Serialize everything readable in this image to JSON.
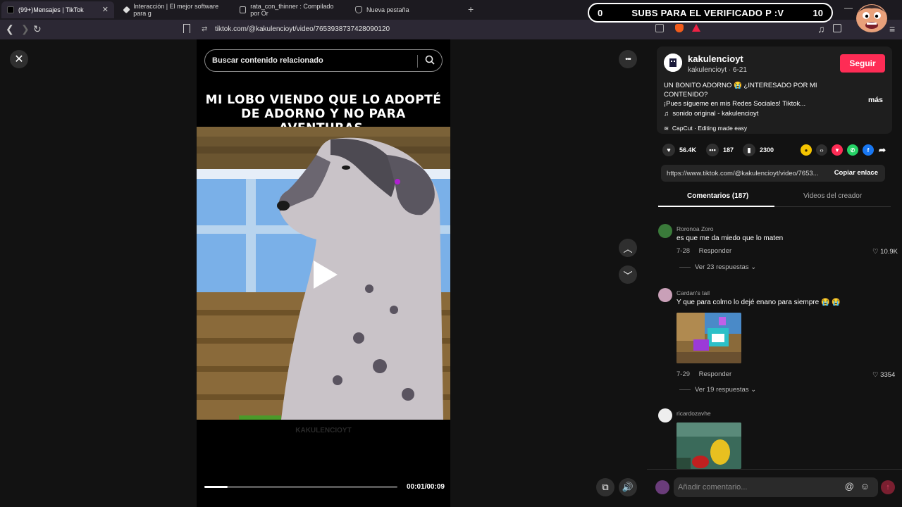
{
  "browser": {
    "tabs": [
      {
        "label": "(99+)Mensajes | TikTok",
        "favicon_color": "#000000"
      },
      {
        "label": "Interacción | El mejor software para g",
        "favicon_color": "#dddddd"
      },
      {
        "label": "rata_con_thinner : Compilado por Or",
        "favicon_color": "#bbbbbb"
      },
      {
        "label": "Nueva pestaña",
        "favicon_color": "#aaaaaa"
      }
    ],
    "tab_close": "✕",
    "new_tab": "+",
    "url": "tiktok.com/@kakulencioyt/video/7653938737428090120",
    "window_controls": {
      "minimize": "—"
    }
  },
  "overlay": {
    "left_count": "0",
    "message": "SUBS PARA EL VERIFICADO P :V",
    "right_count": "10"
  },
  "video": {
    "search_placeholder": "Buscar contenido relacionado",
    "caption_line1": "MI LOBO VIENDO QUE LO ADOPTÉ",
    "caption_line2": "DE ADORNO Y NO PARA AVENTURAS.",
    "watermark": "KAKULENCIOYT",
    "progress_fraction": 0.12,
    "timecode": "00:01/00:09",
    "close_icon": "✕",
    "more_icon": "•••"
  },
  "post": {
    "username": "kakulencioyt",
    "userline": "kakulencioyt · 6-21",
    "follow_label": "Seguir",
    "description_line1": "UN BONITO ADORNO 😭 ¿INTERESADO POR MI CONTENIDO?",
    "description_line2": "¡Pues sígueme en mis Redes Sociales! Tiktok...",
    "more_label": "más",
    "sound": "sonido original - kakulencioyt",
    "capcut": "CapCut · Editing made easy",
    "likes": "56.4K",
    "comments": "187",
    "saves": "2300",
    "link": "https://www.tiktok.com/@kakulencioyt/video/7653...",
    "copy_label": "Copiar enlace",
    "accent_color": "#fe2c55"
  },
  "tabs": {
    "comments_label": "Comentarios (187)",
    "creator_label": "Videos del creador"
  },
  "comments": [
    {
      "user": "Roronoa Zoro",
      "text": "es que me da miedo que lo maten",
      "date": "7-28",
      "reply": "Responder",
      "likes": "10.9K",
      "more": "Ver 23 respuestas ⌄"
    },
    {
      "user": "Cardan's tail",
      "text": "Y que para colmo lo dejé enano para siempre 😭 😭",
      "date": "7-29",
      "reply": "Responder",
      "likes": "3354",
      "more": "Ver 19 respuestas ⌄"
    },
    {
      "user": "ricardozavhe"
    }
  ],
  "comment_bar": {
    "placeholder": "Añadir comentario...",
    "at": "@",
    "emoji": "☺",
    "send": "↑"
  }
}
